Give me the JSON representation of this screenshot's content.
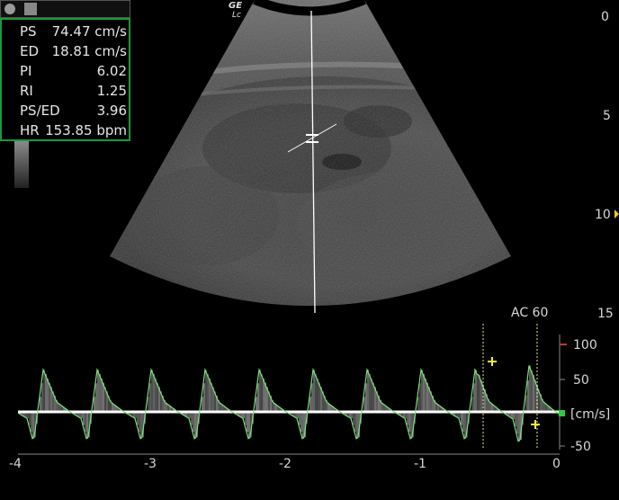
{
  "header": {
    "logo": "GE",
    "probe": "Lc"
  },
  "measurements": [
    {
      "label": "PS",
      "value": "74.47 cm/s"
    },
    {
      "label": "ED",
      "value": "18.81 cm/s"
    },
    {
      "label": "PI",
      "value": "6.02"
    },
    {
      "label": "RI",
      "value": "1.25"
    },
    {
      "label": "PS/ED",
      "value": "3.96"
    },
    {
      "label": "HR",
      "value": "153.85 bpm"
    }
  ],
  "depth_scale": [
    "0",
    "5",
    "10",
    "15"
  ],
  "doppler": {
    "preset": "AC 60",
    "unit": "[cm/s]",
    "velocity_ticks": [
      "100",
      "50",
      "-50"
    ],
    "time_ticks": [
      "-4",
      "-3",
      "-2",
      "-1",
      "0"
    ]
  },
  "colors": {
    "box_border": "#1b9a3a",
    "trace": "#7be37b",
    "caliper": "#f2ef3a",
    "scale_marker": "#c0392b"
  }
}
